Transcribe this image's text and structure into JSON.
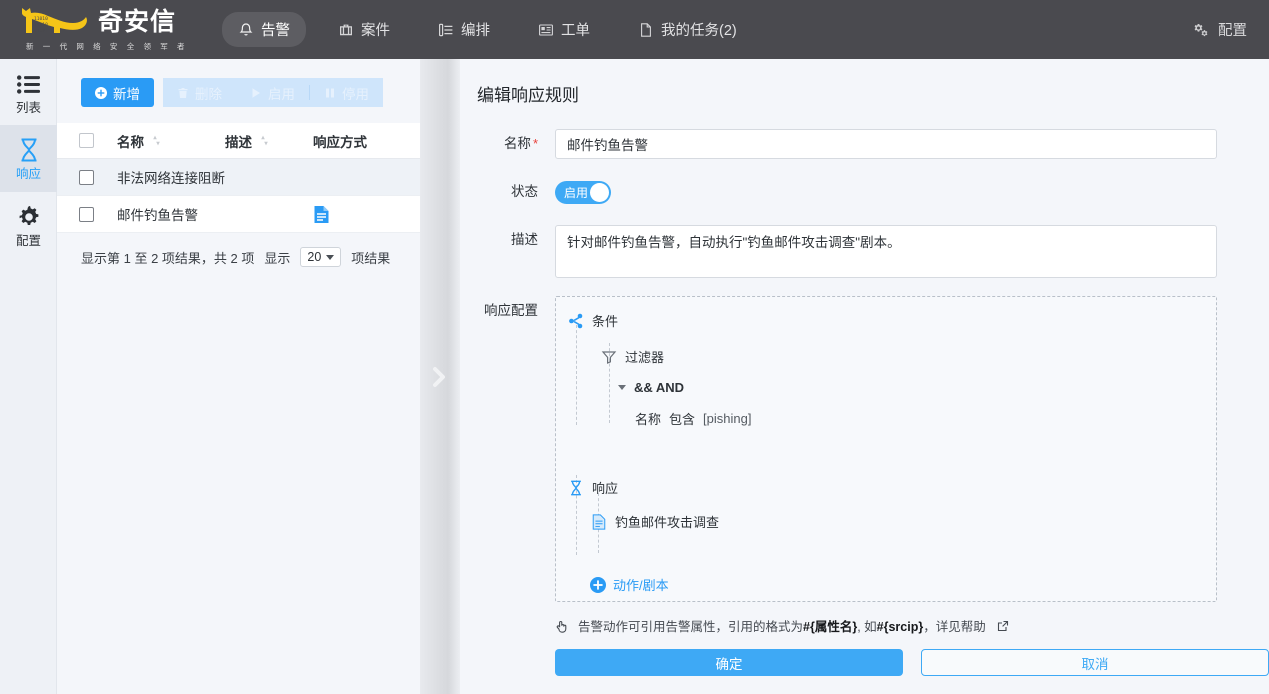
{
  "header": {
    "brand_name": "奇安信",
    "brand_tagline": "新 一 代 网 络 安 全 领 军 者",
    "nav": [
      {
        "label": "告警",
        "icon": "bell-icon",
        "active": true
      },
      {
        "label": "案件",
        "icon": "briefcase-icon",
        "active": false
      },
      {
        "label": "编排",
        "icon": "flow-icon",
        "active": false
      },
      {
        "label": "工单",
        "icon": "ticket-icon",
        "active": false
      },
      {
        "label": "我的任务(2)",
        "icon": "document-icon",
        "active": false
      }
    ],
    "config_label": "配置",
    "config_icon": "gears-icon"
  },
  "rail": {
    "items": [
      {
        "label": "列表",
        "icon": "list-icon",
        "active": false
      },
      {
        "label": "响应",
        "icon": "hourglass-icon",
        "active": true
      },
      {
        "label": "配置",
        "icon": "gear-icon",
        "active": false
      }
    ]
  },
  "list_panel": {
    "toolbar": {
      "add_label": "新增",
      "delete_label": "删除",
      "enable_label": "启用",
      "disable_label": "停用"
    },
    "columns": [
      "名称",
      "描述",
      "响应方式"
    ],
    "rows": [
      {
        "name": "非法网络连接阻断",
        "desc": "",
        "response": ""
      },
      {
        "name": "邮件钓鱼告警",
        "desc": "",
        "response": "doc-icon"
      }
    ],
    "pagination": {
      "summary": "显示第 1 至 2 项结果，共 2 项",
      "show_label": "显示",
      "page_size": "20",
      "unit_label": "项结果"
    }
  },
  "form": {
    "title": "编辑响应规则",
    "name_label": "名称",
    "name_value": "邮件钓鱼告警",
    "status_label": "状态",
    "status_toggle_text": "启用",
    "desc_label": "描述",
    "desc_value": "针对邮件钓鱼告警，自动执行\"钓鱼邮件攻击调查\"剧本。",
    "config_label": "响应配置",
    "tree": {
      "condition_label": "条件",
      "condition_icon": "share-nodes-icon",
      "filter_label": "过滤器",
      "filter_icon": "funnel-icon",
      "operator_label": "&& AND",
      "rule_field": "名称",
      "rule_op": "包含",
      "rule_value": "[pishing]",
      "response_label": "响应",
      "response_icon": "hourglass-icon",
      "playbook_label": "钓鱼邮件攻击调查",
      "playbook_icon": "doc-icon",
      "add_label": "动作/剧本",
      "add_icon": "plus-circle-icon"
    },
    "hint": {
      "icon": "hand-point-icon",
      "text_1": "告警动作可引用告警属性，引用的格式为",
      "bold_1": "#{属性名}",
      "text_2": ", 如",
      "bold_2": "#{srcip}",
      "text_3": "，详见帮助",
      "link_icon": "external-link-icon"
    },
    "confirm_label": "确定",
    "cancel_label": "取消"
  },
  "colors": {
    "header_bg": "#4a4a4f",
    "accent": "#2a9bf5",
    "brand_yellow": "#f5c518",
    "page_bg": "#f4f6fa",
    "required_red": "#e8403a"
  }
}
